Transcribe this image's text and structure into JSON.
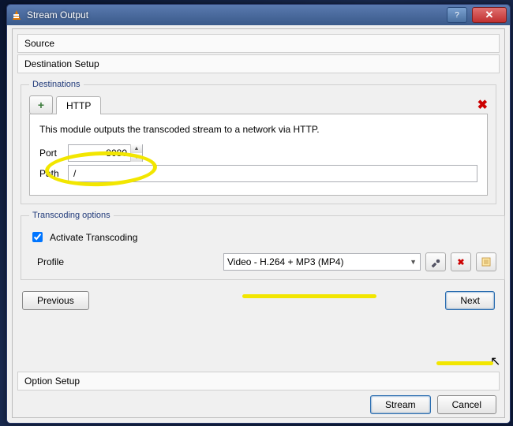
{
  "window": {
    "title": "Stream Output"
  },
  "sections": {
    "source": "Source",
    "dest_setup": "Destination Setup",
    "option_setup": "Option Setup"
  },
  "destinations": {
    "legend": "Destinations",
    "add_tab_label": "+",
    "active_tab": "HTTP",
    "close_label": "✖",
    "description": "This module outputs the transcoded stream to a network via HTTP.",
    "port_label": "Port",
    "port_value": "8080",
    "path_label": "Path",
    "path_value": "/"
  },
  "transcoding": {
    "legend": "Transcoding options",
    "activate_label": "Activate Transcoding",
    "activate_checked": true,
    "profile_label": "Profile",
    "profile_selected": "Video - H.264 + MP3 (MP4)"
  },
  "nav": {
    "previous": "Previous",
    "next": "Next"
  },
  "footer": {
    "stream": "Stream",
    "cancel": "Cancel"
  },
  "icons": {
    "help": "?",
    "close": "✕",
    "tools": "tools-icon",
    "delete": "✖",
    "new": "new-icon"
  }
}
